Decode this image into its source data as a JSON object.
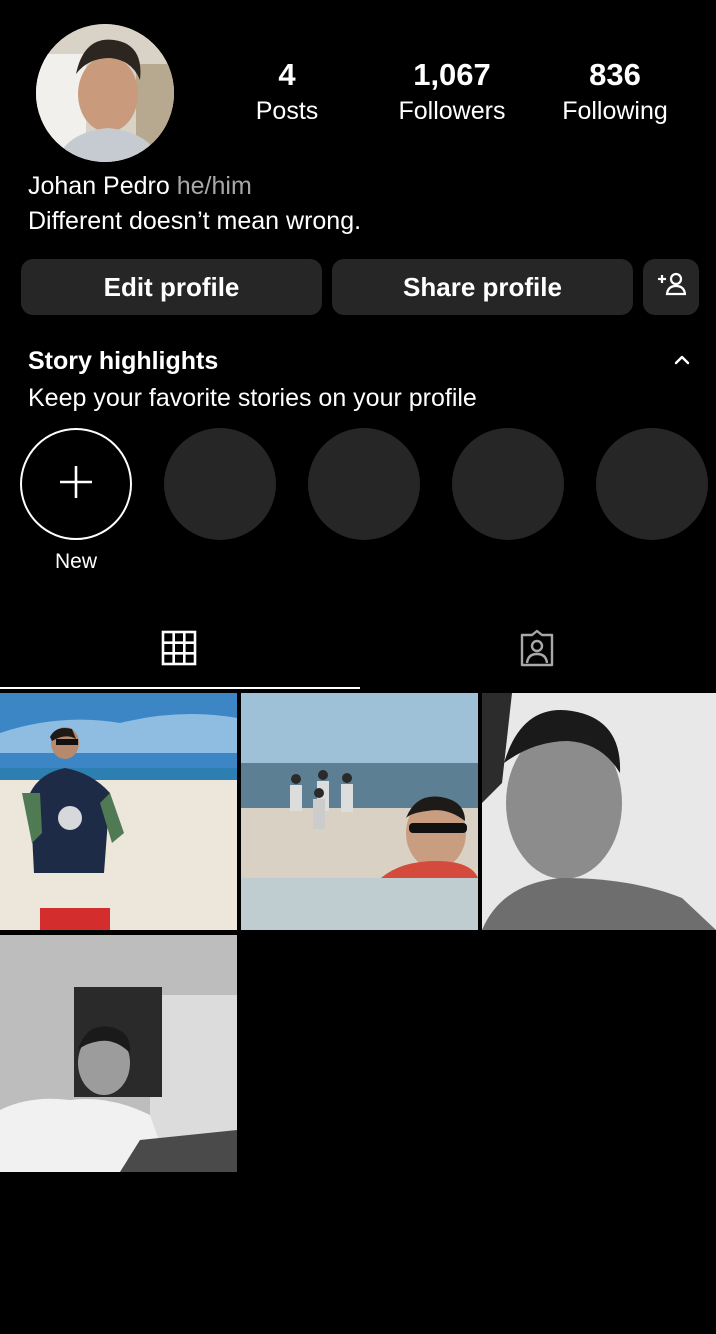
{
  "profile": {
    "name": "Johan Pedro",
    "pronouns": "he/him",
    "bio": "Different doesn’t mean wrong.",
    "avatar_icon": "profile-photo"
  },
  "stats": [
    {
      "value": "4",
      "label": "Posts"
    },
    {
      "value": "1,067",
      "label": "Followers"
    },
    {
      "value": "836",
      "label": "Following"
    }
  ],
  "buttons": {
    "edit": "Edit profile",
    "share": "Share profile",
    "add_icon": "add-person-icon"
  },
  "highlights": {
    "title": "Story highlights",
    "subtitle": "Keep your favorite stories on your profile",
    "new_label": "New"
  },
  "tabs": [
    {
      "icon": "grid-icon",
      "active": true
    },
    {
      "icon": "tagged-icon",
      "active": false
    }
  ],
  "posts": [
    {
      "description": "beach-photo"
    },
    {
      "description": "beach-group-photo"
    },
    {
      "description": "selfie-bw"
    },
    {
      "description": "guitar-bw"
    }
  ],
  "colors": {
    "background": "#000000",
    "button_bg": "#262626",
    "secondary_text": "#a8a8a8"
  }
}
